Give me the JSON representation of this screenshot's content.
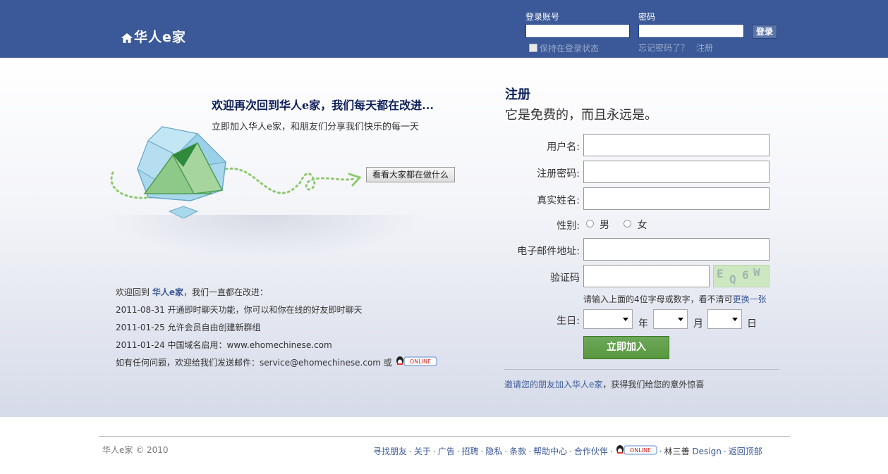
{
  "header": {
    "logo": "华人e家",
    "account_label": "登录账号",
    "password_label": "密码",
    "login_button": "登录",
    "remember": "保持在登录状态",
    "forgot": "忘记密码了？",
    "register_link": "注册"
  },
  "intro": {
    "title": "欢迎再次回到华人e家，我们每天都在改进...",
    "subtitle": "立即加入华人e家，和朋友们分享我们快乐的每一天",
    "see_button": "看看大家都在做什么"
  },
  "news": {
    "intro_prefix": "欢迎回到",
    "intro_brand": "华人e家",
    "intro_suffix": "，我们一直都在改进：",
    "items": [
      "2011-08-31 开通即时聊天功能，你可以和你在线的好友即时聊天",
      "2011-01-25 允许会员自由创建新群组",
      "2011-01-24 中国域名启用：www.ehomechinese.com"
    ],
    "contact": "如有任何问题，欢迎给我们发送邮件：service@ehomechinese.com 或",
    "online_badge": "ONLINE"
  },
  "register": {
    "title": "注册",
    "subtitle": "它是免费的，而且永远是。",
    "username_label": "用户名:",
    "password_label": "注册密码:",
    "realname_label": "真实姓名:",
    "gender_label": "性别:",
    "male": "男",
    "female": "女",
    "email_label": "电子邮件地址:",
    "captcha_label": "验证码",
    "captcha_text": [
      "E",
      "Q",
      "6",
      "W"
    ],
    "captcha_hint": "请输入上面的4位字母或数字，看不清可",
    "captcha_refresh": "更换一张",
    "birthday_label": "生日:",
    "year_unit": "年",
    "month_unit": "月",
    "day_unit": "日",
    "submit": "立即加入",
    "invite": "邀请您的朋友加入华人e家",
    "invite_suffix": "，获得我们给您的意外惊喜"
  },
  "footer": {
    "copyright": "华人e家 © 2010",
    "links": [
      "寻找朋友",
      "关于",
      "广告",
      "招聘",
      "隐私",
      "条款",
      "帮助中心",
      "合作伙伴"
    ],
    "online_badge": "ONLINE",
    "designer": "林三善",
    "design": "Design",
    "back_top": "返回顶部"
  },
  "colors": {
    "brand": "#3b5998",
    "submit_green": "#5e9e47"
  }
}
